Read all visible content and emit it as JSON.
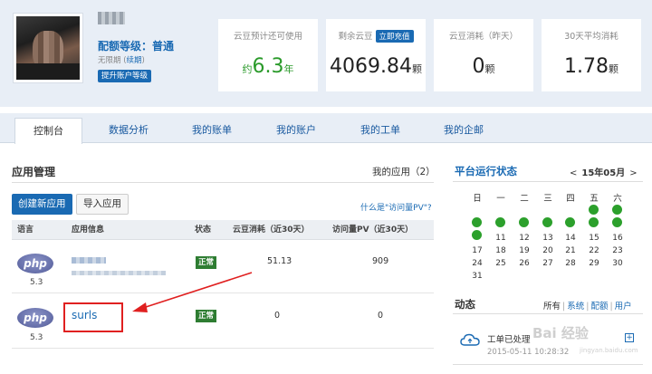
{
  "header": {
    "username_obscured": "",
    "quota_level": "配额等级：普通",
    "expire_prefix": "无限期 (",
    "renew_link": "续期",
    "expire_suffix": ")",
    "upgrade_button": "提升账户等级",
    "stats": [
      {
        "label": "云豆预计还可使用",
        "prefix": "约",
        "value": "6.3",
        "unit": "年"
      },
      {
        "label": "剩余云豆",
        "action": "立即充值",
        "value": "4069.84",
        "unit": "颗"
      },
      {
        "label": "云豆消耗（昨天）",
        "value": "0",
        "unit": "颗"
      },
      {
        "label": "30天平均消耗",
        "value": "1.78",
        "unit": "颗"
      }
    ]
  },
  "tabs": [
    {
      "label": "控制台",
      "active": true
    },
    {
      "label": "数据分析"
    },
    {
      "label": "我的账单"
    },
    {
      "label": "我的账户"
    },
    {
      "label": "我的工单"
    },
    {
      "label": "我的企邮"
    }
  ],
  "apps": {
    "title": "应用管理",
    "my_apps": "我的应用（2）",
    "create_button": "创建新应用",
    "import_button": "导入应用",
    "pv_help": "什么是\"访问量PV\"?",
    "columns": [
      "语言",
      "应用信息",
      "状态",
      "云豆消耗（近30天）",
      "访问量PV（近30天）"
    ],
    "rows": [
      {
        "lang_icon": "php",
        "version": "5.3",
        "name": "",
        "status": "正常",
        "beans": "51.13",
        "pv": "909"
      },
      {
        "lang_icon": "php",
        "version": "5.3",
        "name": "surls",
        "status": "正常",
        "beans": "0",
        "pv": "0"
      }
    ]
  },
  "platform": {
    "title": "平台运行状态",
    "prev": "<",
    "month": "15年05月",
    "next": ">",
    "weekdays": [
      "日",
      "一",
      "二",
      "三",
      "四",
      "五",
      "六"
    ],
    "status_color": "#2ca02c"
  },
  "news": {
    "title": "动态",
    "filters": [
      "所有",
      "系统",
      "配额",
      "用户"
    ],
    "items": [
      {
        "text": "工单已处理",
        "time": "2015-05-11 10:28:32"
      }
    ]
  },
  "watermark": {
    "text": "Bai 经验",
    "sub": "jingyan.baidu.com"
  }
}
